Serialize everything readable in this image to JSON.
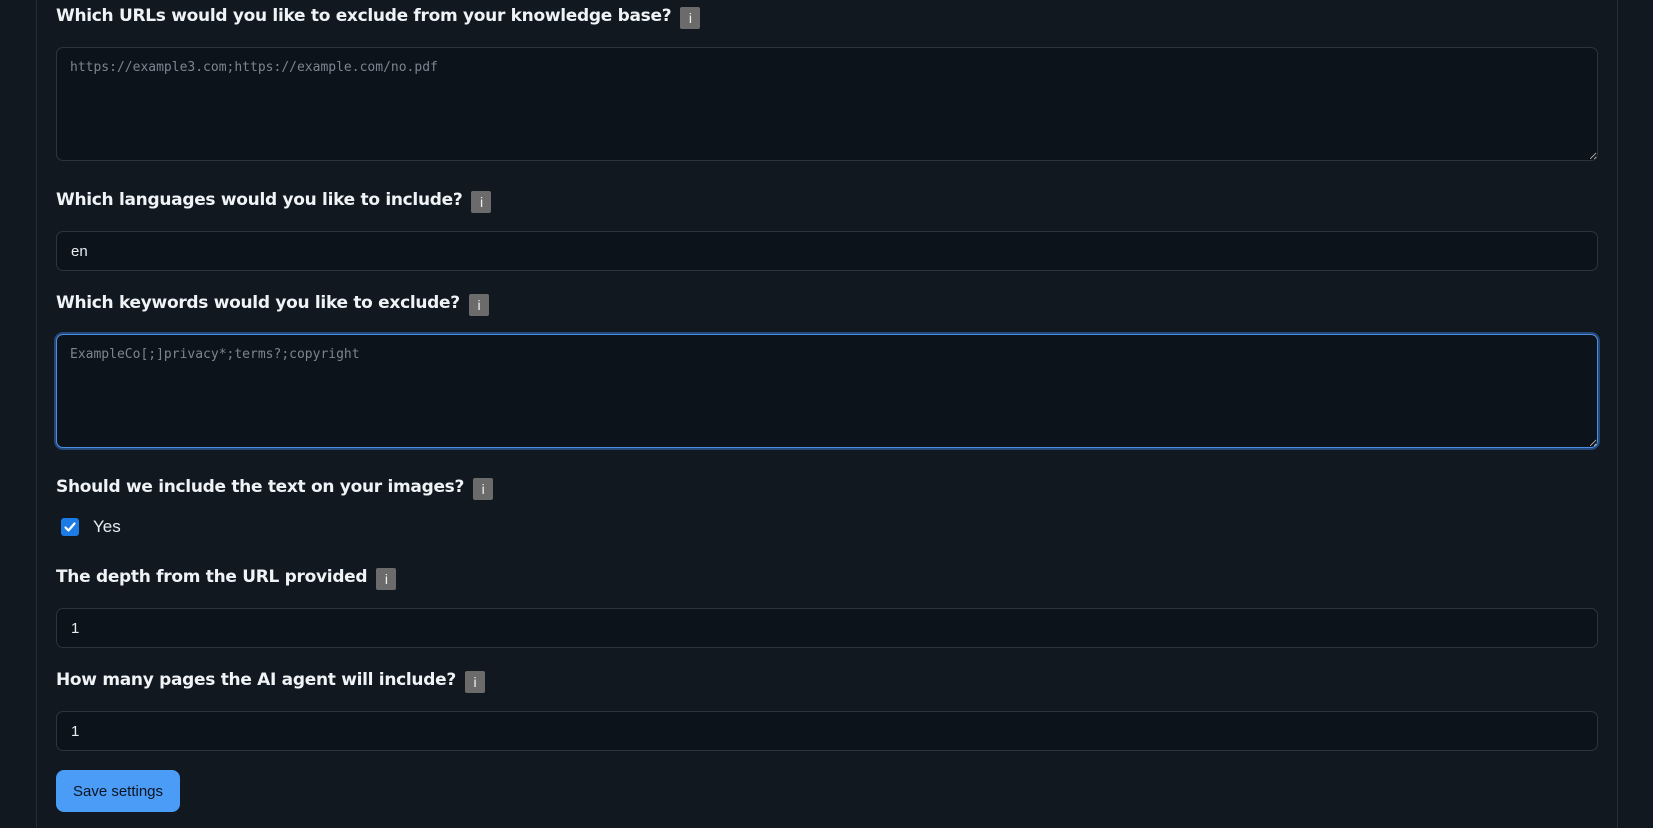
{
  "form": {
    "exclude_urls": {
      "label": "Which URLs would you like to exclude from your knowledge base?",
      "info": "i",
      "placeholder": "https://example3.com;https://example.com/no.pdf",
      "value": ""
    },
    "languages": {
      "label": "Which languages would you like to include?",
      "info": "i",
      "value": "en"
    },
    "exclude_keywords": {
      "label": "Which keywords would you like to exclude?",
      "info": "i",
      "placeholder": "ExampleCo[;]privacy*;terms?;copyright",
      "value": ""
    },
    "include_image_text": {
      "label": "Should we include the text on your images?",
      "info": "i",
      "checkbox_label": "Yes",
      "checked": true
    },
    "depth": {
      "label": "The depth from the URL provided",
      "info": "i",
      "value": "1"
    },
    "pages": {
      "label": "How many pages the AI agent will include?",
      "info": "i",
      "value": "1"
    },
    "save_label": "Save settings"
  },
  "colors": {
    "background": "#111820",
    "accent": "#4a9cf7",
    "checkbox": "#1d7be6"
  }
}
